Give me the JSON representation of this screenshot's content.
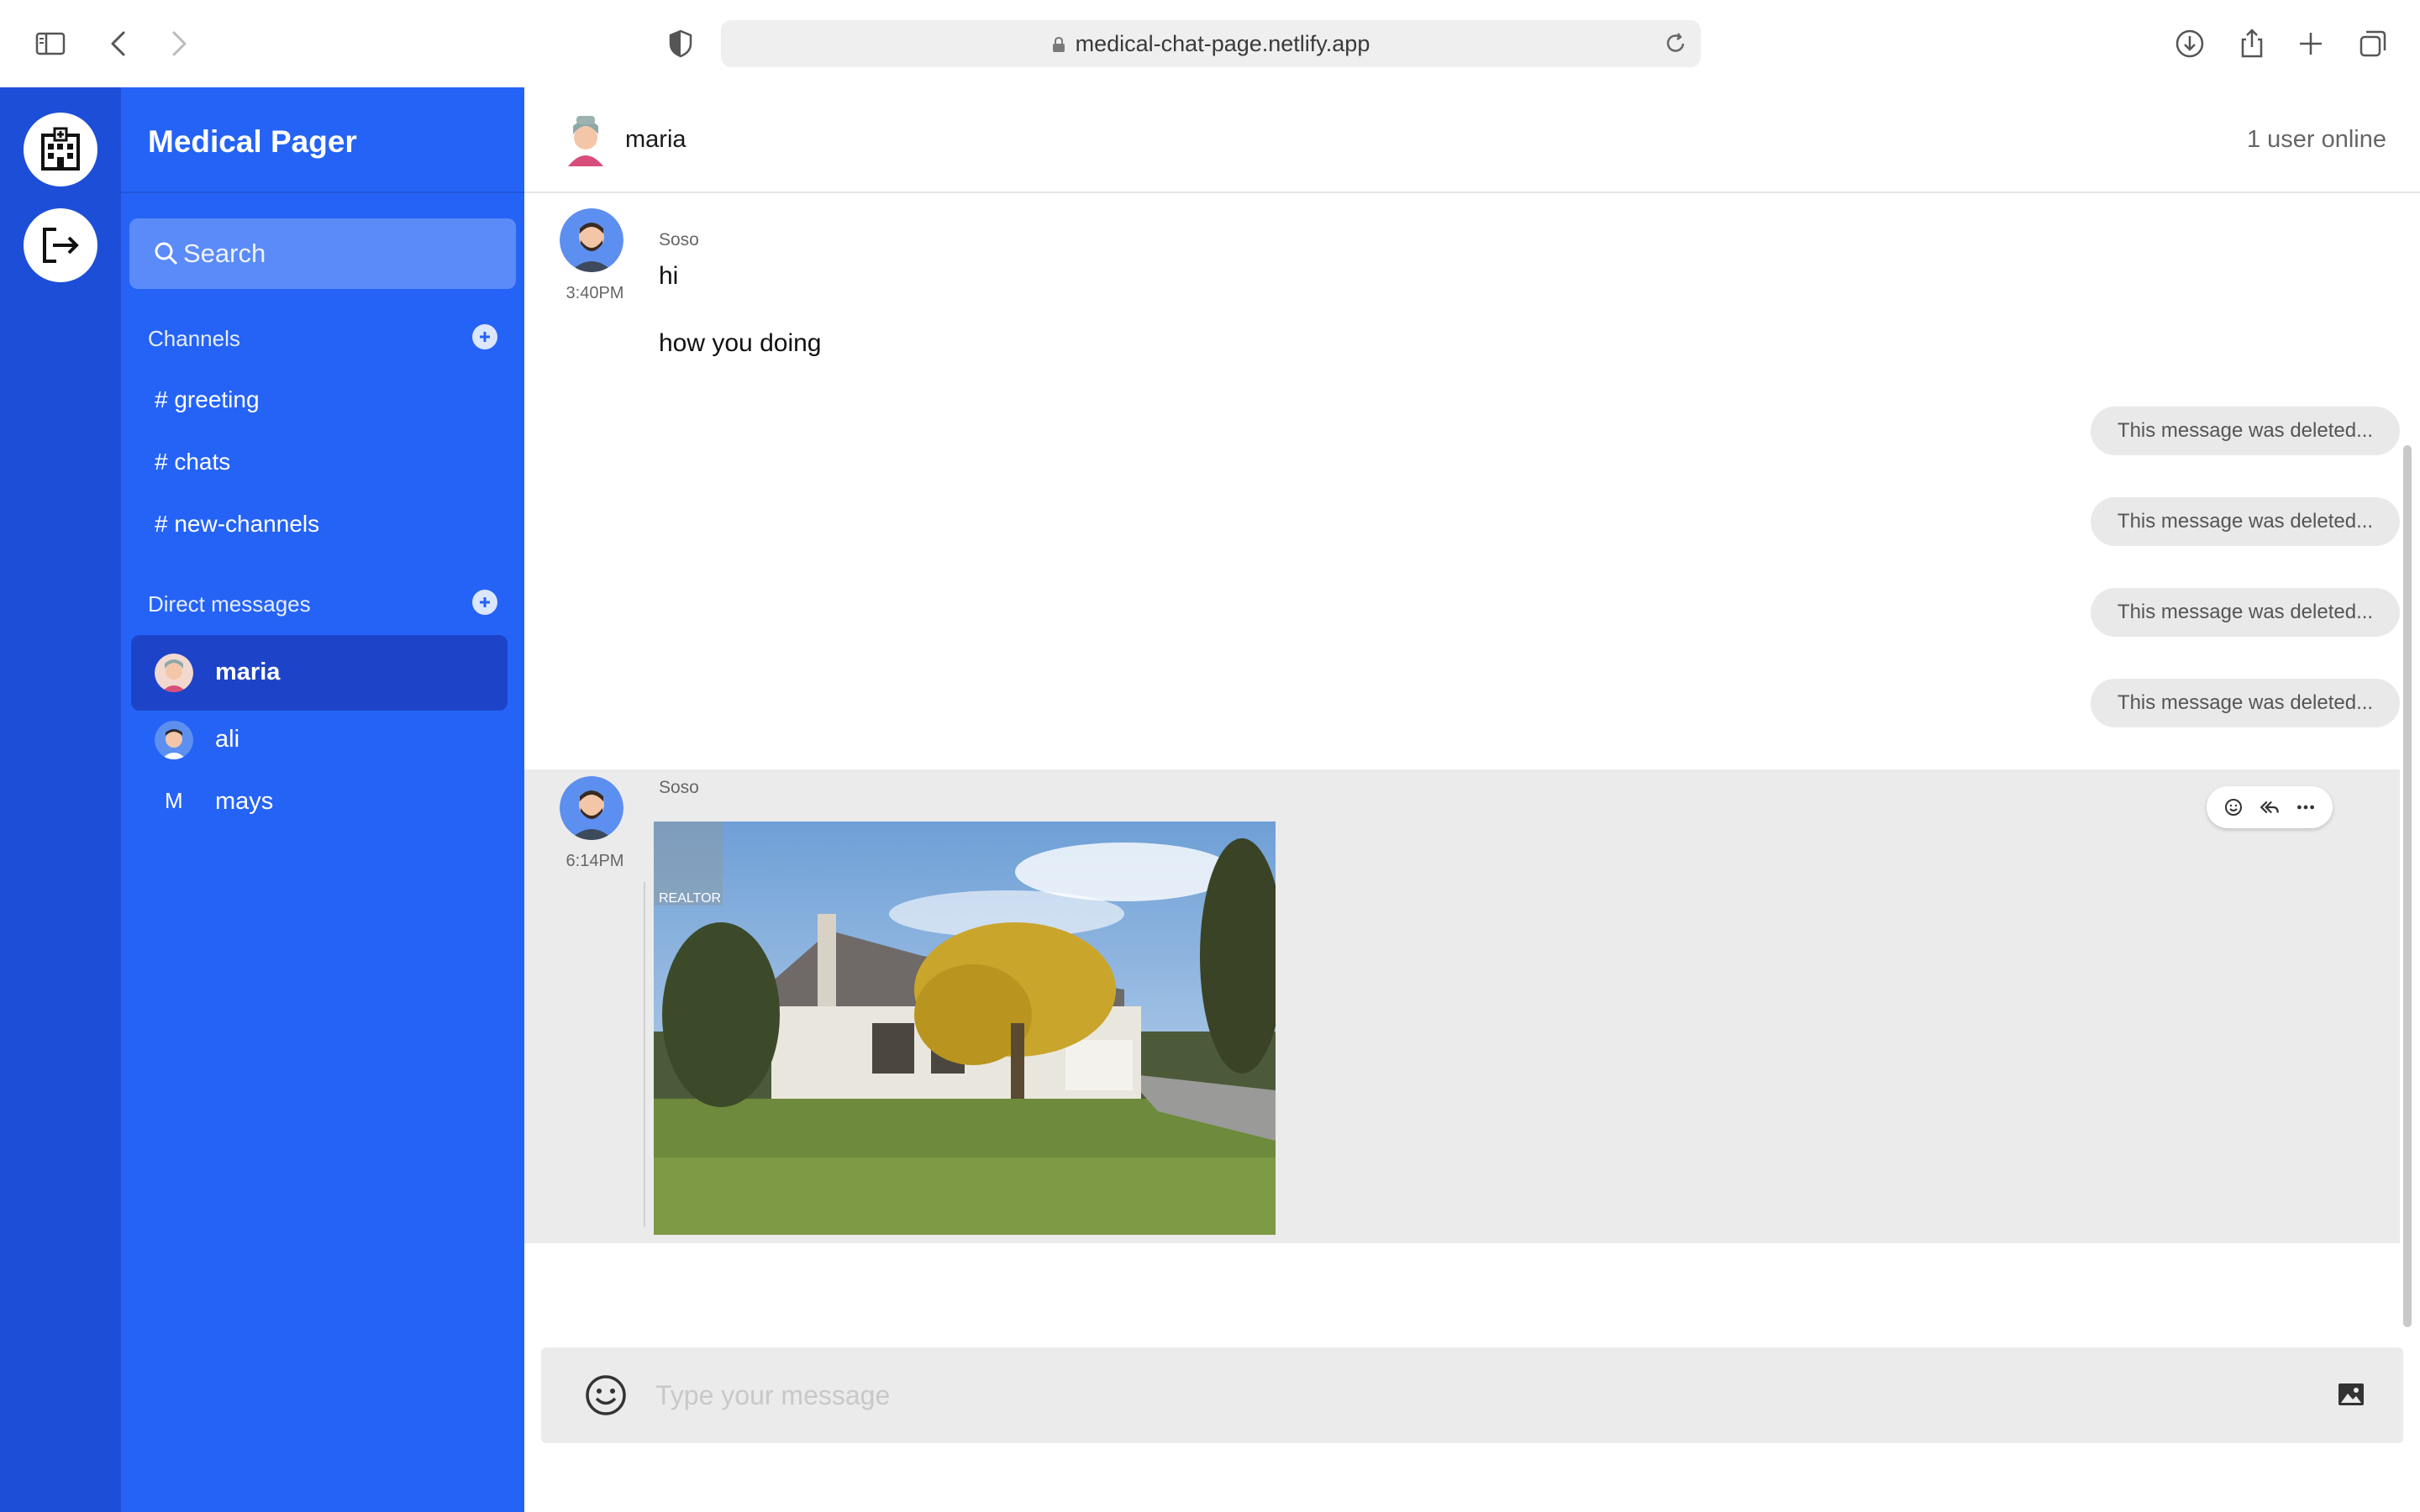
{
  "browser": {
    "url": "medical-chat-page.netlify.app"
  },
  "sidebar": {
    "app_title": "Medical Pager",
    "search_placeholder": "Search",
    "channels_heading": "Channels",
    "channels": [
      {
        "label": "# greeting"
      },
      {
        "label": "# chats"
      },
      {
        "label": "# new-channels"
      }
    ],
    "dm_heading": "Direct messages",
    "direct_messages": [
      {
        "name": "maria",
        "active": true,
        "avatar": "maria-avatar"
      },
      {
        "name": "ali",
        "active": false,
        "avatar": "ali-avatar"
      },
      {
        "name": "mays",
        "active": false,
        "initial": "M"
      }
    ]
  },
  "header": {
    "user_name": "maria",
    "online": "1 user online"
  },
  "messages": [
    {
      "author": "Soso",
      "time": "3:40PM",
      "lines": [
        "hi",
        "how you doing"
      ]
    },
    {
      "deleted": "This message was deleted..."
    },
    {
      "deleted": "This message was deleted..."
    },
    {
      "deleted": "This message was deleted..."
    },
    {
      "deleted": "This message was deleted..."
    },
    {
      "author": "Soso",
      "time": "6:14PM",
      "attachment": "house-photo",
      "watermark": "REALTOR"
    }
  ],
  "composer": {
    "placeholder": "Type your message"
  },
  "colors": {
    "rail": "#1d4ed8",
    "sidebar": "#2563f6",
    "active_dm": "#1d44c8"
  }
}
